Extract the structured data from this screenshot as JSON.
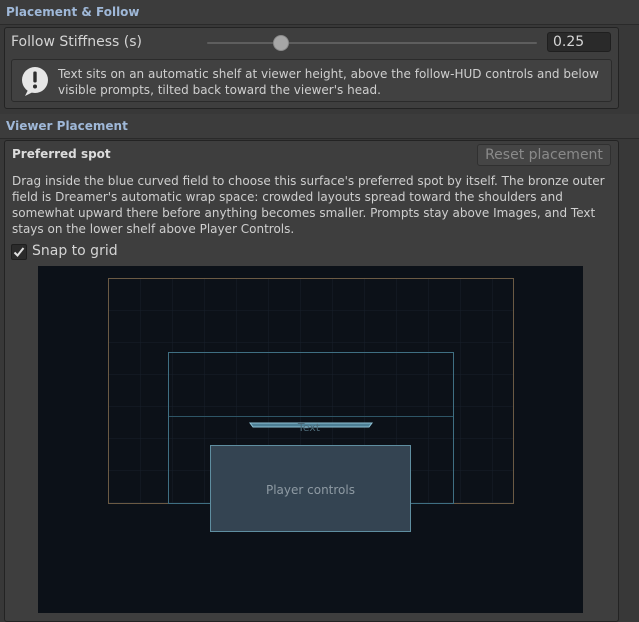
{
  "placement_follow": {
    "title": "Placement & Follow",
    "follow_stiffness": {
      "label": "Follow Stiffness (s)",
      "value": "0.25",
      "slider_fraction": 0.22
    },
    "help": {
      "icon": "warning-icon",
      "text": "Text sits on an automatic shelf at viewer height, above the follow-HUD controls and below visible prompts, tilted back toward the viewer's head."
    }
  },
  "viewer_placement": {
    "title": "Viewer Placement",
    "preferred_spot": {
      "label": "Preferred spot",
      "reset_label": "Reset placement",
      "description": "Drag inside the blue curved field to choose this surface's preferred spot by itself. The bronze outer field is Dreamer's automatic wrap space: crowded layouts spread toward the shoulders and somewhat upward there before anything becomes smaller. Prompts stay above Images, and Text stays on the lower shelf above Player Controls."
    },
    "snap_to_grid": {
      "label": "Snap to grid",
      "checked": true
    },
    "viewport": {
      "text_marker_label": "Text",
      "player_controls_label": "Player controls",
      "colors": {
        "background": "#0c1118",
        "bronze_field": "#6b5a44",
        "blue_field": "#3f6f82",
        "player_controls_fill": "#344452"
      }
    }
  }
}
